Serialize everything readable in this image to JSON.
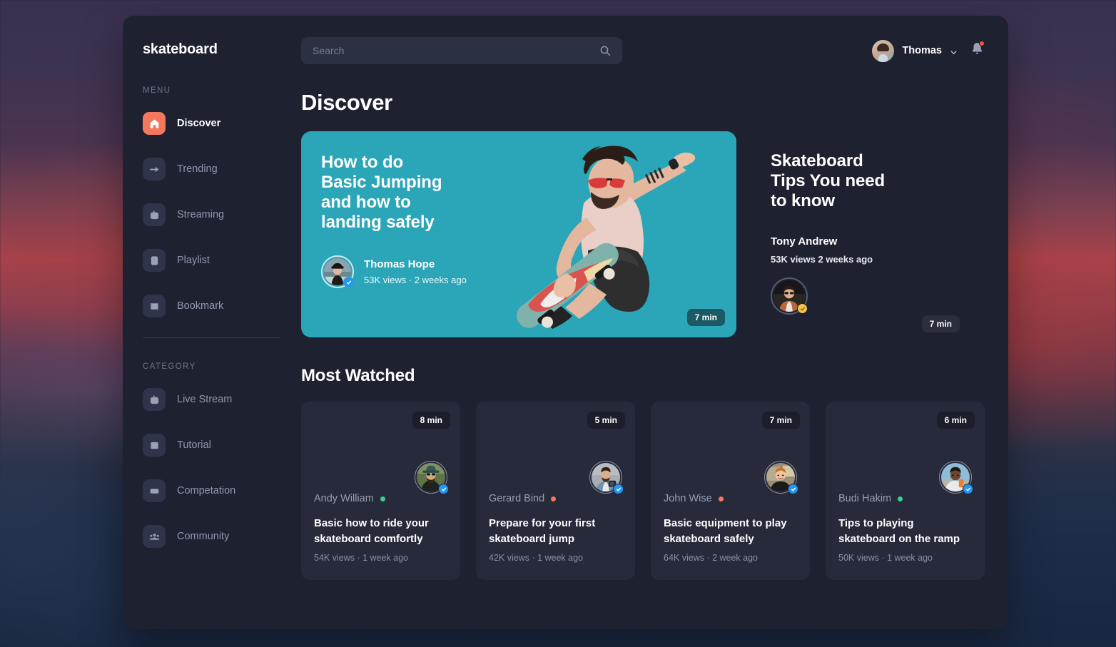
{
  "brand": "skateboard",
  "search": {
    "placeholder": "Search",
    "value": "",
    "icon": "search-icon"
  },
  "user": {
    "name": "Thomas",
    "chevron": "chevron-down-icon",
    "bell": "bell-icon",
    "has_notification": true
  },
  "sidebar": {
    "menu_label": "MENU",
    "menu_items": [
      {
        "label": "Discover",
        "icon": "home-icon",
        "active": true
      },
      {
        "label": "Trending",
        "icon": "trending-icon",
        "active": false
      },
      {
        "label": "Streaming",
        "icon": "streaming-icon",
        "active": false
      },
      {
        "label": "Playlist",
        "icon": "playlist-icon",
        "active": false
      },
      {
        "label": "Bookmark",
        "icon": "bookmark-icon",
        "active": false
      }
    ],
    "category_label": "CATEGORY",
    "category_items": [
      {
        "label": "Live Stream",
        "icon": "camera-icon"
      },
      {
        "label": "Tutorial",
        "icon": "book-icon"
      },
      {
        "label": "Competation",
        "icon": "ticket-icon"
      },
      {
        "label": "Community",
        "icon": "people-icon"
      }
    ]
  },
  "page": {
    "title": "Discover"
  },
  "hero": {
    "headline": "How to do\nBasic Jumping\nand how to\nlanding safely",
    "author": "Thomas Hope",
    "stats": "53K views  ·  2 weeks ago",
    "duration": "7 min",
    "verified": true,
    "accent_color": "#2ba6b8"
  },
  "hero_side": {
    "title": "Skateboard\nTips You need\nto know",
    "author": "Tony Andrew",
    "stats": "53K views 2 weeks ago",
    "duration": "7 min",
    "verified": true
  },
  "most_watched": {
    "title": "Most Watched",
    "cards": [
      {
        "duration": "8 min",
        "author": "Andy William",
        "status_color": "#3ecf8e",
        "title": "Basic how to ride your\nskateboard comfortly",
        "stats": "54K views  ·  1 week ago",
        "verified": true
      },
      {
        "duration": "5 min",
        "author": "Gerard Bind",
        "status_color": "#f4785c",
        "title": "Prepare for your first\nskateboard jump",
        "stats": "42K views  ·  1 week ago",
        "verified": true
      },
      {
        "duration": "7 min",
        "author": "John Wise",
        "status_color": "#f4785c",
        "title": "Basic equipment to play\nskateboard safely",
        "stats": "64K views  ·  2 week ago",
        "verified": true
      },
      {
        "duration": "6 min",
        "author": "Budi Hakim",
        "status_color": "#3ecf8e",
        "title": "Tips to playing\nskateboard on the ramp",
        "stats": "50K views  ·  1 week ago",
        "verified": true
      }
    ]
  },
  "colors": {
    "app_bg": "#1e2130",
    "card_bg": "#262a3a",
    "accent_coral": "#f4785c",
    "accent_teal": "#2ba6b8",
    "verified_blue": "#2196f3",
    "online_green": "#3ecf8e"
  }
}
